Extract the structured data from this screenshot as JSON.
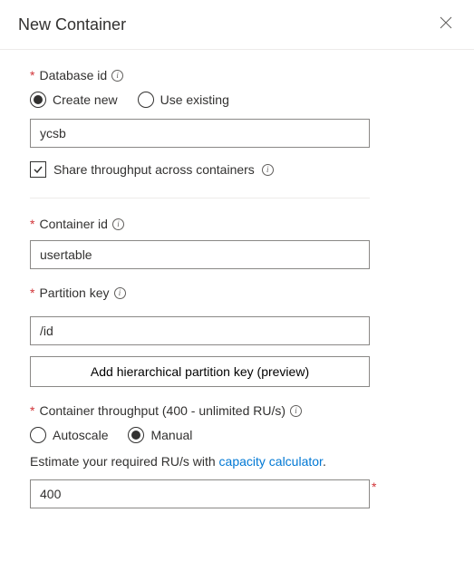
{
  "header": {
    "title": "New Container"
  },
  "database": {
    "label": "Database id",
    "radio_create": "Create new",
    "radio_existing": "Use existing",
    "value": "ycsb",
    "share_label": "Share throughput across containers"
  },
  "container": {
    "label": "Container id",
    "value": "usertable"
  },
  "partition": {
    "label": "Partition key",
    "value": "/id",
    "hierarchical_btn": "Add hierarchical partition key (preview)"
  },
  "throughput": {
    "label": "Container throughput (400 - unlimited RU/s)",
    "radio_autoscale": "Autoscale",
    "radio_manual": "Manual",
    "estimate_prefix": "Estimate your required RU/s with ",
    "estimate_link": "capacity calculator",
    "estimate_suffix": ".",
    "value": "400"
  }
}
